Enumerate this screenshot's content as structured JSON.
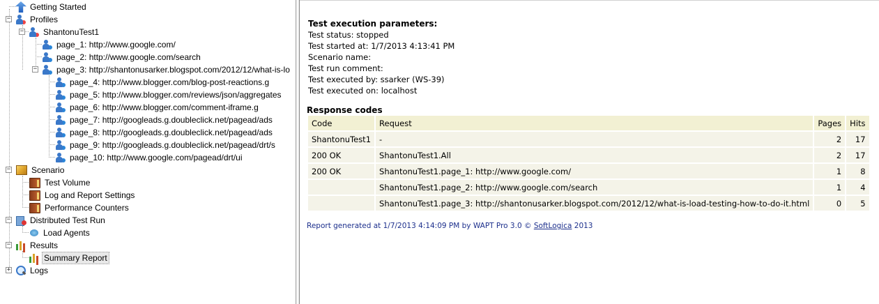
{
  "tree": {
    "getting_started": "Getting Started",
    "profiles": "Profiles",
    "profile_name": "ShantonuTest1",
    "pages": [
      "page_1: http://www.google.com/",
      "page_2: http://www.google.com/search",
      "page_3: http://shantonusarker.blogspot.com/2012/12/what-is-lo"
    ],
    "subpages": [
      "page_4: http://www.blogger.com/blog-post-reactions.g",
      "page_5: http://www.blogger.com/reviews/json/aggregates",
      "page_6: http://www.blogger.com/comment-iframe.g",
      "page_7: http://googleads.g.doubleclick.net/pagead/ads",
      "page_8: http://googleads.g.doubleclick.net/pagead/ads",
      "page_9: http://googleads.g.doubleclick.net/pagead/drt/s",
      "page_10: http://www.google.com/pagead/drt/ui"
    ],
    "scenario": "Scenario",
    "scenario_items": [
      "Test Volume",
      "Log and Report Settings",
      "Performance Counters"
    ],
    "distributed": "Distributed Test Run",
    "load_agents": "Load Agents",
    "results": "Results",
    "summary_report": "Summary Report",
    "logs": "Logs",
    "toggle_minus": "−",
    "toggle_plus": "+"
  },
  "report": {
    "params_title": "Test execution parameters:",
    "params": [
      "Test status: stopped",
      "Test started at: 1/7/2013 4:13:41 PM",
      "Scenario name:",
      "Test run comment:",
      "Test executed by: ssarker (WS-39)",
      "Test executed on: localhost"
    ],
    "codes_title": "Response codes",
    "headers": {
      "code": "Code",
      "request": "Request",
      "pages": "Pages",
      "hits": "Hits"
    },
    "rows": [
      {
        "code": "ShantonuTest1",
        "request": "-",
        "pages": "2",
        "hits": "17"
      },
      {
        "code": "200 OK",
        "request": "ShantonuTest1.All",
        "pages": "2",
        "hits": "17"
      },
      {
        "code": "200 OK",
        "request": "ShantonuTest1.page_1: http://www.google.com/",
        "pages": "1",
        "hits": "8"
      },
      {
        "code": "",
        "request": "ShantonuTest1.page_2: http://www.google.com/search",
        "pages": "1",
        "hits": "4"
      },
      {
        "code": "",
        "request": "ShantonuTest1.page_3: http://shantonusarker.blogspot.com/2012/12/what-is-load-testing-how-to-do-it.html",
        "pages": "0",
        "hits": "5"
      }
    ],
    "footer_prefix": "Report generated at 1/7/2013 4:14:09 PM by WAPT Pro 3.0 © ",
    "footer_link": "SoftLogica",
    "footer_suffix": " 2013"
  },
  "colors": {
    "header_bg": "#f2f0d3",
    "cell_bg": "#f4f3e8",
    "footer_text": "#1c2f8c"
  }
}
